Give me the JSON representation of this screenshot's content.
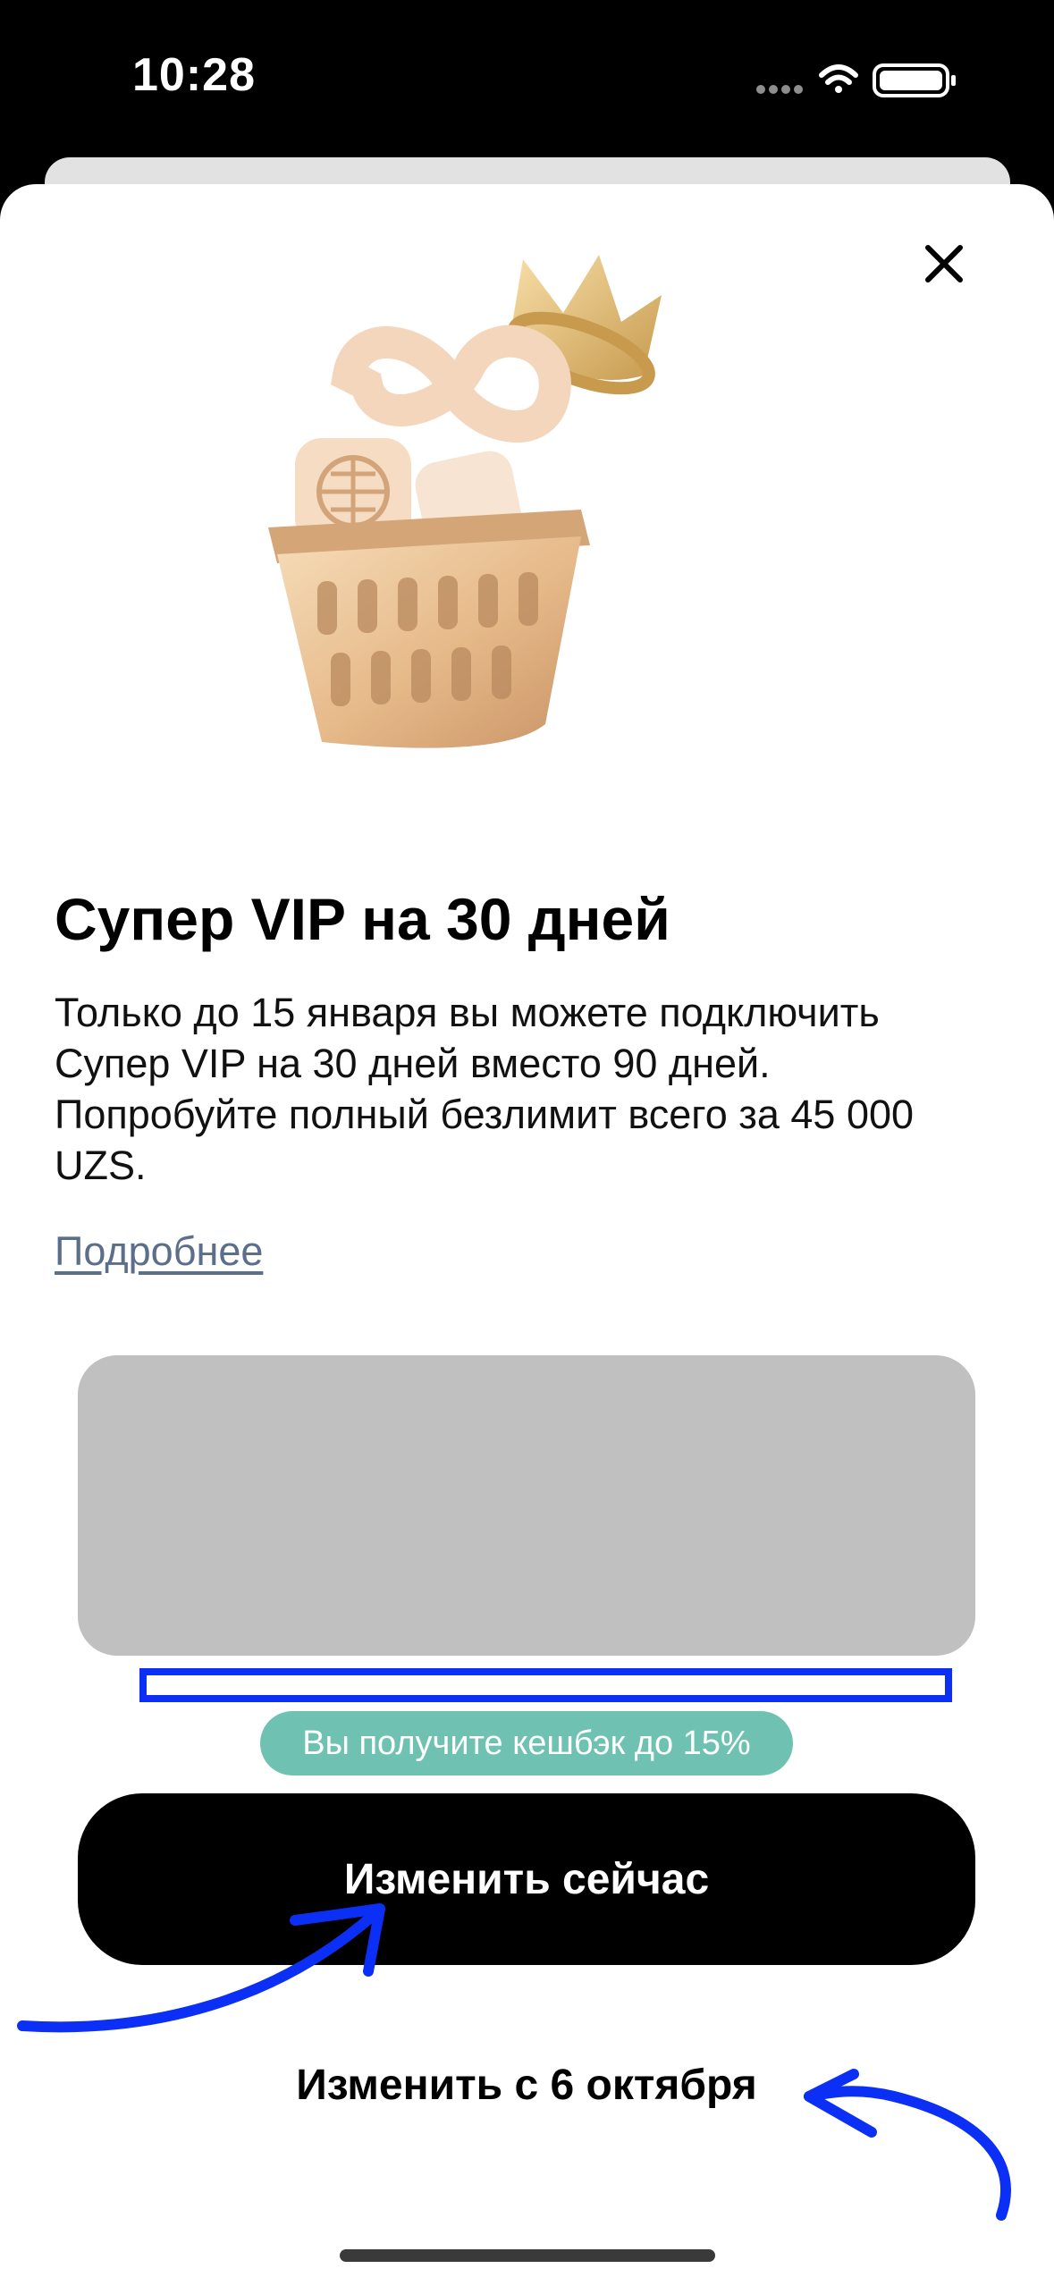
{
  "status_bar": {
    "time": "10:28",
    "icons": [
      "signal-dots-icon",
      "wifi-icon",
      "battery-icon"
    ]
  },
  "sheet": {
    "close_icon": "close-icon",
    "hero_image": "golden-basket-with-crown",
    "title": "Супер VIP на 30 дней",
    "description": "Только до 15 января вы можете подключить Супер VIP на 30 дней вместо 90 дней. Попробуйте полный безлимит всего за 45 000 UZS.",
    "more_link": "Подробнее",
    "cashback_badge": "Вы получите кешбэк до 15%",
    "primary_button": "Изменить сейчас",
    "secondary_button": "Изменить с 6 октября"
  },
  "colors": {
    "accent_annotation": "#0b2ff5",
    "cashback_badge": "#6fc2b2",
    "link": "#5b6e8a",
    "placeholder": "#c0c0c0",
    "primary_button": "#000000"
  }
}
